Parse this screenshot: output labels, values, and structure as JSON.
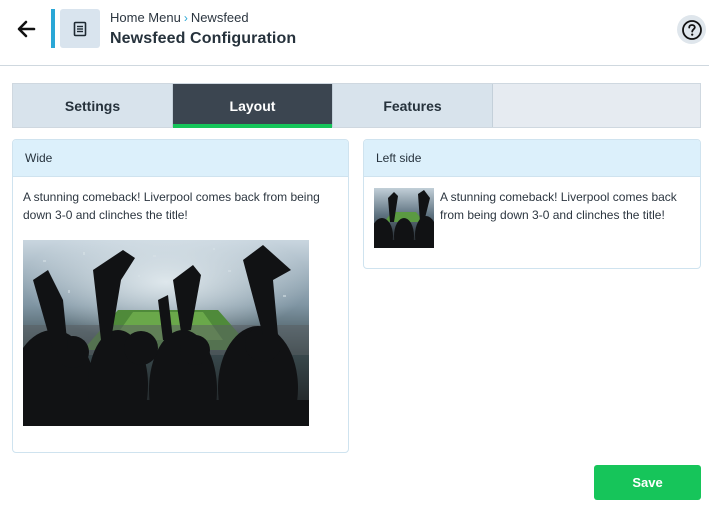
{
  "header": {
    "breadcrumb": {
      "root": "Home Menu",
      "current": "Newsfeed"
    },
    "title": "Newsfeed Configuration",
    "icons": {
      "back": "arrow-left-icon",
      "doc": "document-icon",
      "help": "help-circle-icon"
    }
  },
  "tabs": [
    {
      "label": "Settings",
      "active": false
    },
    {
      "label": "Layout",
      "active": true
    },
    {
      "label": "Features",
      "active": false
    }
  ],
  "layouts": {
    "wide": {
      "heading": "Wide",
      "text": "A stunning comeback! Liverpool comes back from being down 3-0 and clinches the title!",
      "image": "stadium-crowd-photo"
    },
    "left_side": {
      "heading": "Left side",
      "text": "A stunning comeback! Liverpool comes back from being down 3-0 and clinches the title!",
      "image": "stadium-crowd-photo"
    }
  },
  "actions": {
    "save_label": "Save"
  },
  "colors": {
    "accent": "#2aa7d6",
    "active_tab": "#3b4550",
    "success": "#16c55a",
    "card_header": "#dcf0fb"
  }
}
